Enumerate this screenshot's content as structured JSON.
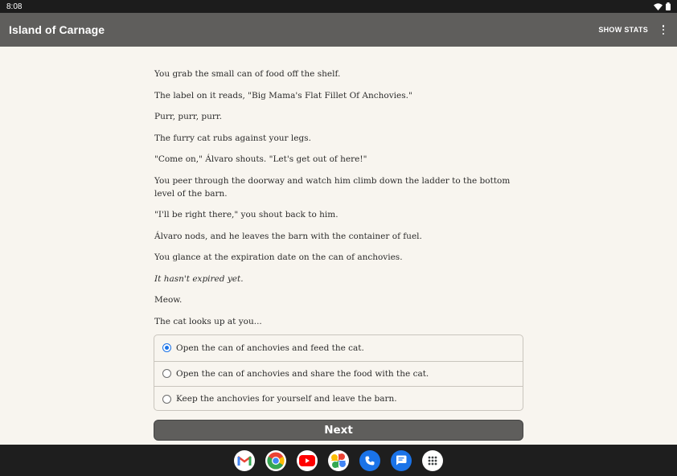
{
  "status": {
    "time": "8:08"
  },
  "app": {
    "title": "Island of Carnage",
    "show_stats": "SHOW STATS"
  },
  "story": {
    "paragraphs": [
      {
        "text": "You grab the small can of food off the shelf.",
        "italic": false
      },
      {
        "text": "The label on it reads, \"Big Mama's Flat Fillet Of Anchovies.\"",
        "italic": false
      },
      {
        "text": "Purr, purr, purr.",
        "italic": false
      },
      {
        "text": "The furry cat rubs against your legs.",
        "italic": false
      },
      {
        "text": "\"Come on,\" Álvaro shouts. \"Let's get out of here!\"",
        "italic": false
      },
      {
        "text": "You peer through the doorway and watch him climb down the ladder to the bottom level of the barn.",
        "italic": false
      },
      {
        "text": "\"I'll be right there,\" you shout back to him.",
        "italic": false
      },
      {
        "text": "Álvaro nods, and he leaves the barn with the container of fuel.",
        "italic": false
      },
      {
        "text": "You glance at the expiration date on the can of anchovies.",
        "italic": false
      },
      {
        "text": "It hasn't expired yet.",
        "italic": true
      },
      {
        "text": "Meow.",
        "italic": false
      },
      {
        "text": "The cat looks up at you...",
        "italic": false
      }
    ]
  },
  "choices": [
    {
      "label": "Open the can of anchovies and feed the cat.",
      "selected": true
    },
    {
      "label": "Open the can of anchovies and share the food with the cat.",
      "selected": false
    },
    {
      "label": "Keep the anchovies for yourself and leave the barn.",
      "selected": false
    }
  ],
  "next_label": "Next",
  "dock": [
    "gmail-icon",
    "chrome-icon",
    "youtube-icon",
    "photos-icon",
    "phone-icon",
    "messages-icon",
    "app-drawer-icon"
  ],
  "colors": {
    "app_bar": "#5f5e5c",
    "background": "#f8f5ef",
    "radio_accent": "#1a73e8"
  }
}
